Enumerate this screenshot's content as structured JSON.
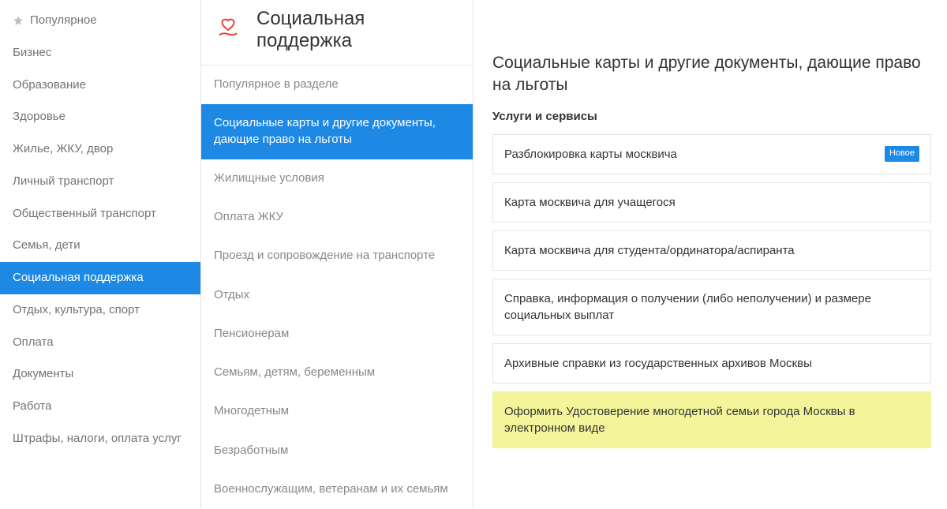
{
  "sidebar": {
    "items": [
      {
        "label": "Популярное",
        "hasStar": true
      },
      {
        "label": "Бизнес"
      },
      {
        "label": "Образование"
      },
      {
        "label": "Здоровье"
      },
      {
        "label": "Жилье, ЖКУ, двор"
      },
      {
        "label": "Личный транспорт"
      },
      {
        "label": "Общественный транспорт"
      },
      {
        "label": "Семья, дети"
      },
      {
        "label": "Социальная поддержка",
        "selected": true
      },
      {
        "label": "Отдых, культура, спорт"
      },
      {
        "label": "Оплата"
      },
      {
        "label": "Документы"
      },
      {
        "label": "Работа"
      },
      {
        "label": "Штрафы, налоги, оплата услуг"
      }
    ]
  },
  "section": {
    "title": "Социальная поддержка"
  },
  "submenu": {
    "items": [
      {
        "label": "Популярное в разделе"
      },
      {
        "label": "Социальные карты и другие документы, дающие право на льготы",
        "selected": true
      },
      {
        "label": "Жилищные условия"
      },
      {
        "label": "Оплата ЖКУ"
      },
      {
        "label": "Проезд и сопровождение на транспорте"
      },
      {
        "label": "Отдых"
      },
      {
        "label": "Пенсионерам"
      },
      {
        "label": "Семьям, детям, беременным"
      },
      {
        "label": "Многодетным"
      },
      {
        "label": "Безработным"
      },
      {
        "label": "Военнослужащим, ветеранам и их семьям"
      }
    ]
  },
  "content": {
    "heading": "Социальные карты и другие документы, дающие право на льготы",
    "subheading": "Услуги и сервисы",
    "services": [
      {
        "label": "Разблокировка карты москвича",
        "badge": "Новое"
      },
      {
        "label": "Карта москвича для учащегося"
      },
      {
        "label": "Карта москвича для студента/ординатора/аспиранта"
      },
      {
        "label": "Справка, информация о получении (либо неполучении) и размере социальных выплат"
      },
      {
        "label": "Архивные справки из государственных архивов Москвы"
      },
      {
        "label": "Оформить Удостоверение многодетной семьи города Москвы в электронном виде",
        "highlight": true
      }
    ]
  }
}
